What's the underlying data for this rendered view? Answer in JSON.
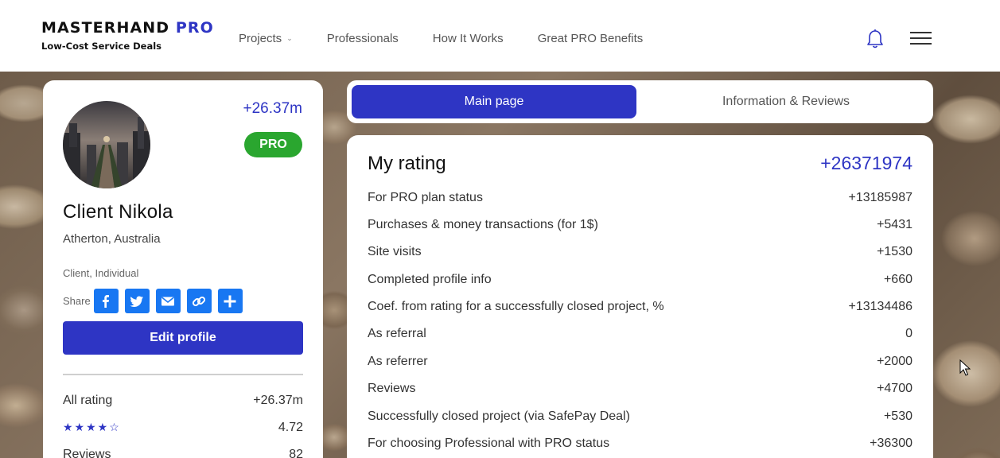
{
  "header": {
    "brand_name": "MASTERHAND",
    "brand_pro": "PRO",
    "brand_tagline": "Low-Cost Service Deals",
    "nav": [
      "Projects",
      "Professionals",
      "How It Works",
      "Great PRO Benefits"
    ],
    "icons": [
      "bell-icon",
      "menu-icon",
      "chevron-down-icon"
    ]
  },
  "profile": {
    "rating_short": "+26.37m",
    "badge": "PRO",
    "name": "Client Nikola",
    "location": "Atherton, Australia",
    "type": "Client, Individual",
    "share_label": "Share",
    "share_icons": [
      "facebook-icon",
      "twitter-icon",
      "email-icon",
      "link-icon",
      "plus-icon"
    ],
    "edit_label": "Edit profile",
    "stats": {
      "all_rating_label": "All rating",
      "all_rating_value": "+26.37m",
      "stars_value": "4.72",
      "stars_filled": 4,
      "reviews_label": "Reviews",
      "reviews_value": "82"
    }
  },
  "tabs": {
    "main": "Main page",
    "info": "Information & Reviews"
  },
  "rating": {
    "title": "My rating",
    "total": "+26371974",
    "rows": [
      {
        "label": "For PRO plan status",
        "value": "+13185987"
      },
      {
        "label": "Purchases & money transactions (for 1$)",
        "value": "+5431"
      },
      {
        "label": "Site visits",
        "value": "+1530"
      },
      {
        "label": "Completed profile info",
        "value": "+660"
      },
      {
        "label": "Coef. from rating for a successfully closed project, %",
        "value": "+13134486"
      },
      {
        "label": "As referral",
        "value": "0"
      },
      {
        "label": "As referrer",
        "value": "+2000"
      },
      {
        "label": "Reviews",
        "value": "+4700"
      },
      {
        "label": "Successfully closed project (via SafePay Deal)",
        "value": "+530"
      },
      {
        "label": "For choosing Professional with PRO status",
        "value": "+36300"
      }
    ]
  },
  "colors": {
    "accent": "#2e35c4",
    "pro_badge": "#2aa62f",
    "share_button": "#1877f2"
  }
}
